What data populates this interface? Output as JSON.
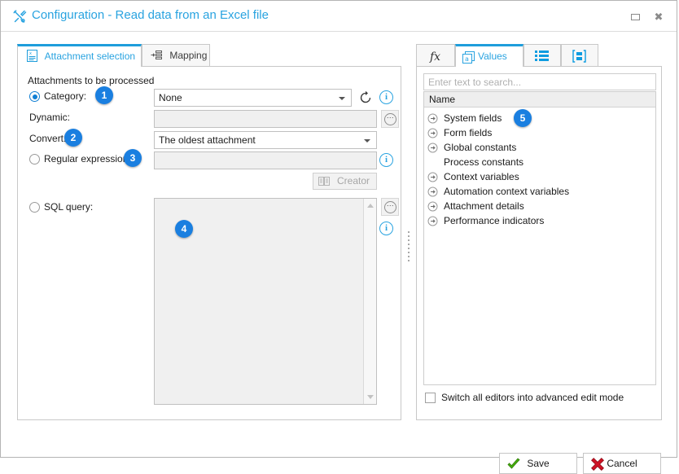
{
  "window": {
    "title": "Configuration - Read data from an Excel file",
    "title_icon": "tools-icon",
    "maximize_label": "Maximize",
    "close_label": "Close"
  },
  "left_panel": {
    "tabs": [
      {
        "label": "Attachment selection",
        "icon": "excel-sheet-icon",
        "active": true
      },
      {
        "label": "Mapping",
        "icon": "mapping-icon",
        "active": false
      }
    ],
    "group_label": "Attachments to be processed",
    "category": {
      "label": "Category:",
      "badge": "1",
      "selected": true,
      "value": "None",
      "refresh_icon": "refresh-icon",
      "info_icon": "info-icon"
    },
    "dynamic": {
      "label": "Dynamic:",
      "value": "",
      "more_button": "ellipsis-button"
    },
    "convert": {
      "label": "Convert:",
      "badge": "2",
      "value": "The oldest attachment"
    },
    "regex": {
      "label": "Regular expression:",
      "badge": "3",
      "selected": false,
      "value": "",
      "info_icon": "info-icon",
      "creator_label": "Creator"
    },
    "sql": {
      "label": "SQL query:",
      "badge": "4",
      "selected": false,
      "value": "",
      "more_button": "ellipsis-button",
      "info_icon": "info-icon"
    }
  },
  "right_panel": {
    "tabs": [
      {
        "label": "",
        "icon": "function-fx-icon",
        "active": false
      },
      {
        "label": "Values",
        "icon": "values-a-icon",
        "active": true
      },
      {
        "label": "",
        "icon": "list-icon",
        "active": false
      },
      {
        "label": "",
        "icon": "boxed-list-icon",
        "active": false
      }
    ],
    "search": {
      "placeholder": "Enter text to search...",
      "value": ""
    },
    "grid": {
      "column_header": "Name",
      "rows": [
        {
          "label": "System fields",
          "expandable": true
        },
        {
          "label": "Form fields",
          "expandable": true
        },
        {
          "label": "Global constants",
          "expandable": true
        },
        {
          "label": "Process constants",
          "expandable": false
        },
        {
          "label": "Context variables",
          "expandable": true
        },
        {
          "label": "Automation context variables",
          "expandable": true
        },
        {
          "label": "Attachment details",
          "expandable": true
        },
        {
          "label": "Performance indicators",
          "expandable": true
        }
      ],
      "badge": "5"
    },
    "advanced_checkbox": {
      "label": "Switch all editors into advanced edit mode",
      "checked": false
    }
  },
  "footer": {
    "save_label": "Save",
    "cancel_label": "Cancel"
  },
  "colors": {
    "accent_blue": "#29a3e0",
    "badge_blue": "#1a7fe0",
    "save_green": "#3aa015",
    "cancel_red": "#cc1122"
  }
}
